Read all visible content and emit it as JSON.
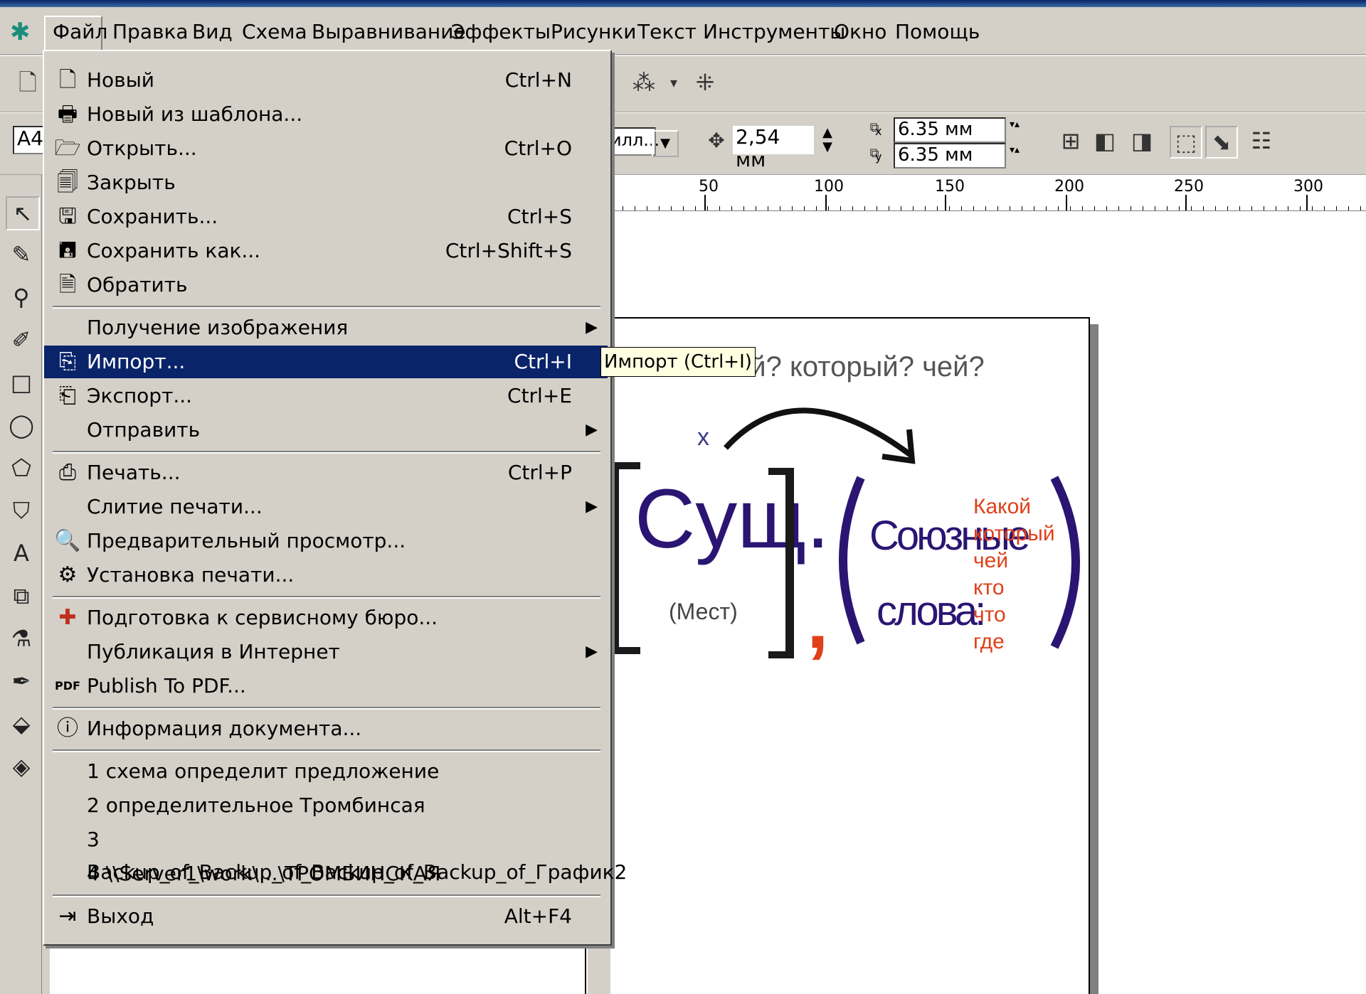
{
  "menubar": {
    "items": [
      "Файл",
      "Правка",
      "Вид",
      "Схема",
      "Выравнивание",
      "Эффекты",
      "Рисунки",
      "Текст",
      "Инструменты",
      "Окно",
      "Помощь"
    ]
  },
  "toolbar": {
    "page_size": "A4",
    "fill_dropdown": "илл...",
    "nudge_value": "2,54 мм",
    "dup_x": "6.35 мм",
    "dup_y": "6.35 мм",
    "x_label": "x",
    "y_label": "y"
  },
  "ruler": {
    "labels": [
      "50",
      "100",
      "150",
      "200",
      "250",
      "300"
    ]
  },
  "file_menu": {
    "items": [
      {
        "label": "Новый",
        "shortcut": "Ctrl+N",
        "icon": "new-document-icon"
      },
      {
        "label": "Новый из шаблона...",
        "shortcut": "",
        "icon": "template-icon"
      },
      {
        "label": "Открыть...",
        "shortcut": "Ctrl+O",
        "icon": "open-folder-icon"
      },
      {
        "label": "Закрыть",
        "shortcut": "",
        "icon": "close-document-icon"
      },
      {
        "label": "Сохранить...",
        "shortcut": "Ctrl+S",
        "icon": "save-icon"
      },
      {
        "label": "Сохранить как...",
        "shortcut": "Ctrl+Shift+S",
        "icon": "save-as-icon"
      },
      {
        "label": "Обратить",
        "shortcut": "",
        "icon": "revert-icon"
      },
      {
        "label": "Получение изображения",
        "shortcut": "",
        "submenu": true
      },
      {
        "label": "Импорт...",
        "shortcut": "Ctrl+I",
        "icon": "import-icon",
        "highlighted": true
      },
      {
        "label": "Экспорт...",
        "shortcut": "Ctrl+E",
        "icon": "export-icon"
      },
      {
        "label": "Отправить",
        "shortcut": "",
        "submenu": true
      },
      {
        "label": "Печать...",
        "shortcut": "Ctrl+P",
        "icon": "print-icon"
      },
      {
        "label": "Слитие печати...",
        "shortcut": "",
        "submenu": true
      },
      {
        "label": "Предварительный просмотр...",
        "shortcut": "",
        "icon": "print-preview-icon"
      },
      {
        "label": "Установка печати...",
        "shortcut": "",
        "icon": "print-setup-icon"
      },
      {
        "label": "Подготовка к сервисному бюро...",
        "shortcut": "",
        "icon": "service-bureau-icon"
      },
      {
        "label": "Публикация в Интернет",
        "shortcut": "",
        "submenu": true
      },
      {
        "label": "Publish To PDF...",
        "shortcut": "",
        "icon": "pdf-icon"
      },
      {
        "label": "Информация документа...",
        "shortcut": "",
        "icon": "info-icon"
      },
      {
        "label": "1 схема определит предложение",
        "shortcut": ""
      },
      {
        "label": "2 определительное Тромбинсая",
        "shortcut": ""
      },
      {
        "label": "3 Backup_of_Backup_of_Backup_of_Backup_of_График2",
        "shortcut": ""
      },
      {
        "label": "4 \\\\Server1\\work\\...\\ТРОМБИНСКАЯ",
        "shortcut": ""
      },
      {
        "label": "Выход",
        "shortcut": "Alt+F4",
        "icon": "exit-icon"
      }
    ]
  },
  "tooltip": "Импорт (Ctrl+I)",
  "canvas": {
    "question": "ой?  который?  чей?",
    "x_mark": "x",
    "noun": "Сущ.",
    "pronoun": "(Мест)",
    "comma": ",",
    "conj_line1": "Союзные",
    "conj_line2": "слова:",
    "words": [
      "Какой",
      "который",
      "чей",
      "кто",
      "что",
      "где"
    ],
    "colors": {
      "purple": "#2a1573",
      "orange": "#e0401a",
      "bracket": "#1a1a1a"
    }
  }
}
